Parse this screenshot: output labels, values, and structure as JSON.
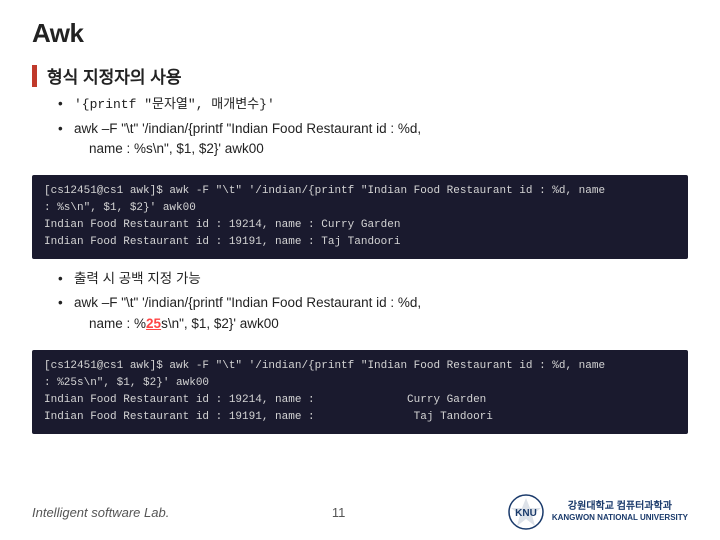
{
  "page": {
    "title": "Awk",
    "section1": {
      "heading": "형식 지정자의 사용",
      "bullets": [
        "'{printf \"문자열\", 매개변수}'",
        "awk –F \"\\t\" '/indian/{printf \"Indian Food Restaurant id : %d, name : %s\\n\", $1, $2}' awk00"
      ]
    },
    "code1": {
      "lines": [
        "[cs12451@cs1 awk]$ awk -F \"\\t\" '/indian/{printf \"Indian Food Restaurant id : %d, name",
        ": %s\\n\", $1, $2}' awk00",
        "Indian Food Restaurant id : 19214, name : Curry Garden",
        "Indian Food Restaurant id : 19191, name : Taj Tandoori"
      ]
    },
    "section2": {
      "bullets": [
        "출력 시 공백 지정 가능",
        "awk –F \"\\t\" '/indian/{printf \"Indian Food Restaurant id : %d, name : %25s\\n\", $1, $2}' awk00"
      ]
    },
    "code2": {
      "lines": [
        "[cs12451@cs1 awk]$ awk -F \"\\t\" '/indian/{printf \"Indian Food Restaurant id : %d, name",
        ": %25s\\n\", $1, $2}' awk00",
        "Indian Food Restaurant id : 19214, name :          Curry Garden",
        "Indian Food Restaurant id : 19191, name :          Taj Tandoori"
      ]
    },
    "footer": {
      "lab": "Intelligent software Lab.",
      "page": "11",
      "university": "강원대학교 컴퓨터과학과",
      "knu": "KNU"
    }
  }
}
